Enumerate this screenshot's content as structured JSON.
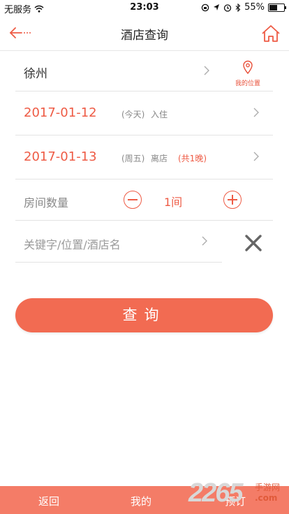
{
  "status_bar": {
    "carrier": "无服务",
    "time": "23:03",
    "battery_text": "55%",
    "battery_level": 0.55
  },
  "nav": {
    "title": "酒店查询",
    "back_icon": "back-arrow-icon",
    "home_icon": "home-icon"
  },
  "city": {
    "value": "徐州",
    "locate_label": "我的位置"
  },
  "checkin": {
    "date": "2017-01-12",
    "weekday": "(今天)",
    "kind": "入住"
  },
  "checkout": {
    "date": "2017-01-13",
    "weekday": "(周五)",
    "kind": "离店",
    "nights": "(共1晚)"
  },
  "rooms": {
    "label": "房间数量",
    "count": "1间"
  },
  "keyword": {
    "placeholder": "关键字/位置/酒店名"
  },
  "search_button": "查询",
  "tabbar": {
    "items": [
      "返回",
      "我的",
      "预订"
    ]
  },
  "watermark": {
    "number": "2265",
    "text_top": "手游网",
    "text_bottom": ".com"
  },
  "colors": {
    "accent": "#ee5b45",
    "button": "#f26b52",
    "tabbar": "#f47c67"
  }
}
